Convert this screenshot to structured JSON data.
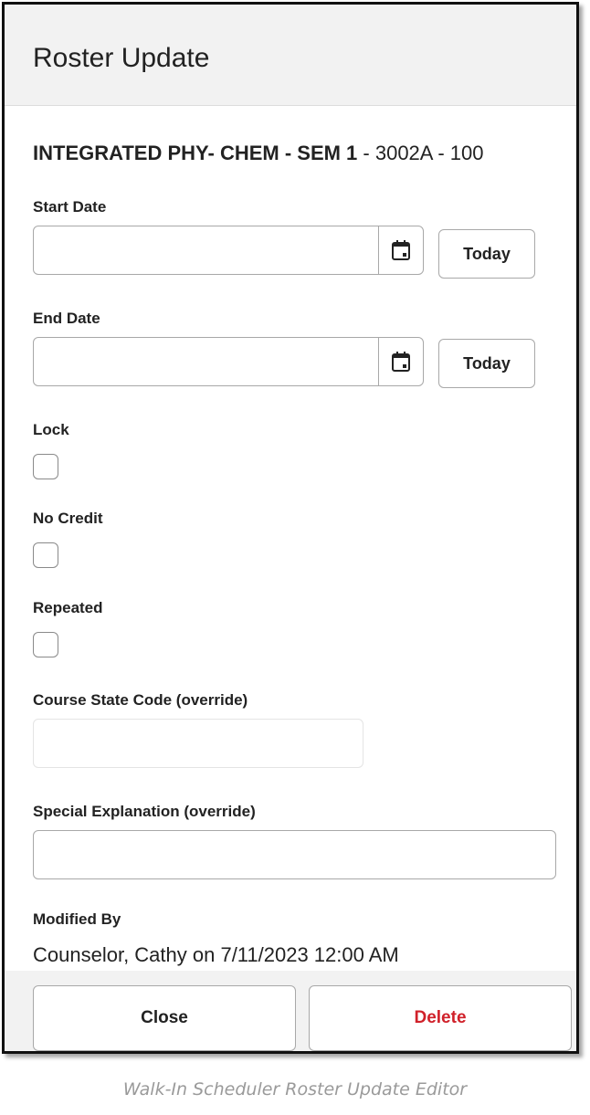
{
  "dialog": {
    "title": "Roster Update",
    "course": {
      "name": "INTEGRATED PHY- CHEM - SEM 1",
      "detail": " - 3002A - 100"
    }
  },
  "form": {
    "start_date": {
      "label": "Start Date",
      "value": "",
      "today_label": "Today",
      "icon": "calendar-icon"
    },
    "end_date": {
      "label": "End Date",
      "value": "",
      "today_label": "Today",
      "icon": "calendar-icon"
    },
    "lock": {
      "label": "Lock",
      "checked": false
    },
    "no_credit": {
      "label": "No Credit",
      "checked": false
    },
    "repeated": {
      "label": "Repeated",
      "checked": false
    },
    "course_state_code": {
      "label": "Course State Code (override)",
      "value": "",
      "disabled": true
    },
    "special_explanation": {
      "label": "Special Explanation (override)",
      "value": ""
    },
    "modified_by": {
      "label": "Modified By",
      "value": "Counselor, Cathy on 7/11/2023 12:00 AM"
    }
  },
  "footer": {
    "close_label": "Close",
    "delete_label": "Delete"
  },
  "colors": {
    "delete_text": "#d0212a",
    "header_bg": "#f2f2f2"
  },
  "caption": "Walk-In Scheduler Roster Update Editor"
}
